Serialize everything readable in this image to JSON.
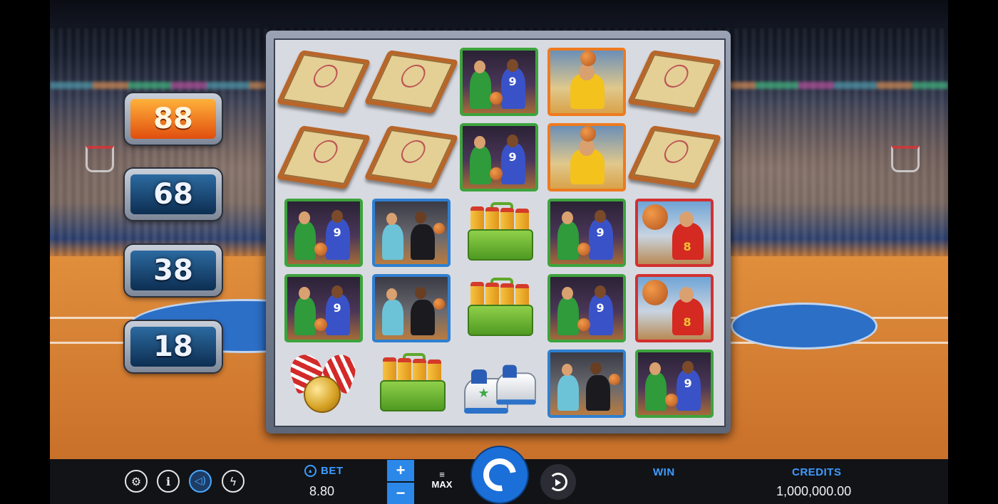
{
  "prizes": [
    {
      "value": "88",
      "highlight": true
    },
    {
      "value": "68",
      "highlight": false
    },
    {
      "value": "38",
      "highlight": false
    },
    {
      "value": "18",
      "highlight": false
    }
  ],
  "reels": [
    [
      "clipboard-icon",
      "clipboard-icon",
      "players-green-icon",
      "shooter-orange-icon",
      "clipboard-icon"
    ],
    [
      "clipboard-icon",
      "clipboard-icon",
      "players-green-icon",
      "shooter-orange-icon",
      "clipboard-icon"
    ],
    [
      "players-green-icon",
      "dribble-blue-icon",
      "bottle-crate-icon",
      "players-green-icon",
      "dunk-red-icon"
    ],
    [
      "players-green-icon",
      "dribble-blue-icon",
      "bottle-crate-icon",
      "players-green-icon",
      "dunk-red-icon"
    ],
    [
      "medal-icon",
      "bottle-crate-icon",
      "sneakers-icon",
      "dribble-blue-icon",
      "players-green-icon"
    ]
  ],
  "controls": {
    "settings_icon": "gear-icon",
    "info_icon": "info-icon",
    "sound_icon": "speaker-icon",
    "turbo_icon": "lightning-icon",
    "bet_label": "BET",
    "bet_value": "8.80",
    "plus_label": "+",
    "minus_label": "−",
    "max_label": "MAX",
    "win_label": "WIN",
    "win_value": "",
    "credits_label": "CREDITS",
    "credits_value": "1,000,000.00"
  },
  "colors": {
    "accent": "#3e9bff",
    "spin_button": "#1b6fd8",
    "prize_highlight": "#e04e0e",
    "prize_default": "#0d2e52"
  }
}
